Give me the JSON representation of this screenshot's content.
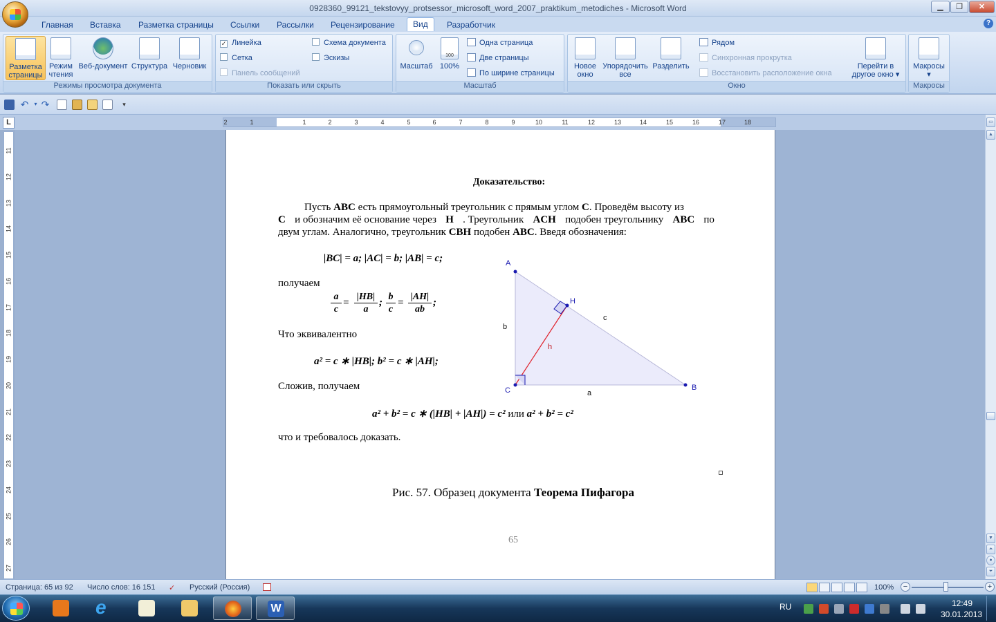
{
  "window": {
    "title": "0928360_99121_tekstovyy_protsessor_microsoft_word_2007_praktikum_metodiches - Microsoft Word"
  },
  "tabs": [
    "Главная",
    "Вставка",
    "Разметка страницы",
    "Ссылки",
    "Рассылки",
    "Рецензирование",
    "Вид",
    "Разработчик"
  ],
  "active_tab": "Вид",
  "ribbon": {
    "views": {
      "label": "Режимы просмотра документа",
      "buttons": [
        "Разметка страницы",
        "Режим чтения",
        "Веб-документ",
        "Структура",
        "Черновик"
      ]
    },
    "show": {
      "label": "Показать или скрыть",
      "ruler": "Линейка",
      "grid": "Сетка",
      "msgbar": "Панель сообщений",
      "docmap": "Схема документа",
      "thumbs": "Эскизы"
    },
    "zoom": {
      "label": "Масштаб",
      "zoom_btn": "Масштаб",
      "pct_btn": "100%",
      "pct_icon": "100",
      "one_page": "Одна страница",
      "two_pages": "Две страницы",
      "page_width": "По ширине страницы"
    },
    "window": {
      "label": "Окно",
      "new_window": "Новое окно",
      "arrange_all": "Упорядочить все",
      "split": "Разделить",
      "side_by_side": "Рядом",
      "sync_scroll": "Синхронная прокрутка",
      "reset_pos": "Восстановить расположение окна",
      "switch": "Перейти в другое окно"
    },
    "macros": {
      "label": "Макросы",
      "button": "Макросы"
    }
  },
  "ruler_marks": [
    "2",
    "1",
    "1",
    "2",
    "3",
    "4",
    "5",
    "6",
    "7",
    "8",
    "9",
    "10",
    "11",
    "12",
    "13",
    "14",
    "15",
    "16",
    "17",
    "18"
  ],
  "vruler_marks": [
    "11",
    "12",
    "13",
    "14",
    "15",
    "16",
    "17",
    "18",
    "19",
    "20",
    "21",
    "22",
    "23",
    "24",
    "25",
    "26",
    "27"
  ],
  "doc": {
    "heading": "Доказательство:",
    "para_lines": [
      [
        "Пусть ",
        "ABC",
        " есть прямоугольный треугольник с прямым углом ",
        "C",
        ". Проведём высоту из"
      ],
      [
        "C",
        " и обозначим её основание через ",
        "H",
        ". Треугольник ",
        "ACH",
        " подобен треугольнику ",
        "ABC",
        " по"
      ],
      [
        "двум углам. Аналогично, треугольник ",
        "CBH",
        " подобен ",
        "ABC",
        ". Введя обозначения:"
      ]
    ],
    "notation": "|BC| = a;  |AC| = b; |AB| = c;",
    "poluchaem": "получаем",
    "frac1_num": "a",
    "frac1_den": "c",
    "eq": "=",
    "frac2_num": "|HB|",
    "frac2_den": "a",
    "semi": ";",
    "frac3_num": "b",
    "frac3_den": "c",
    "frac4_num": "|AH|",
    "frac4_den": "ab",
    "semi2": ";",
    "equivalent": "Что эквивалентно",
    "eq2": "a² = c ∗ |HB|; b² = c ∗ |AH|;",
    "summed": "Сложив, получаем",
    "eq3_a": "a² + b² = c ∗ (|HB| + |AH|) = c²",
    "eq3_or": " или ",
    "eq3_b": "a² + b² = c²",
    "qed": "что и требовалось доказать.",
    "caption_plain": "Рис. 57. Образец документа ",
    "caption_bold": "Теорема Пифагора",
    "page_number": "65"
  },
  "figure": {
    "A": "A",
    "B": "B",
    "C": "C",
    "H": "H",
    "a": "a",
    "b": "b",
    "c": "c",
    "h": "h",
    "fill": "#ebebfb",
    "accent": "#1a1ab0",
    "height_color": "#e0202a"
  },
  "status": {
    "page": "Страница: 65 из 92",
    "words": "Число слов: 16 151",
    "lang": "Русский (Россия)",
    "zoom": "100%"
  },
  "tray": {
    "lang": "RU",
    "time": "12:49",
    "date": "30.01.2013"
  }
}
